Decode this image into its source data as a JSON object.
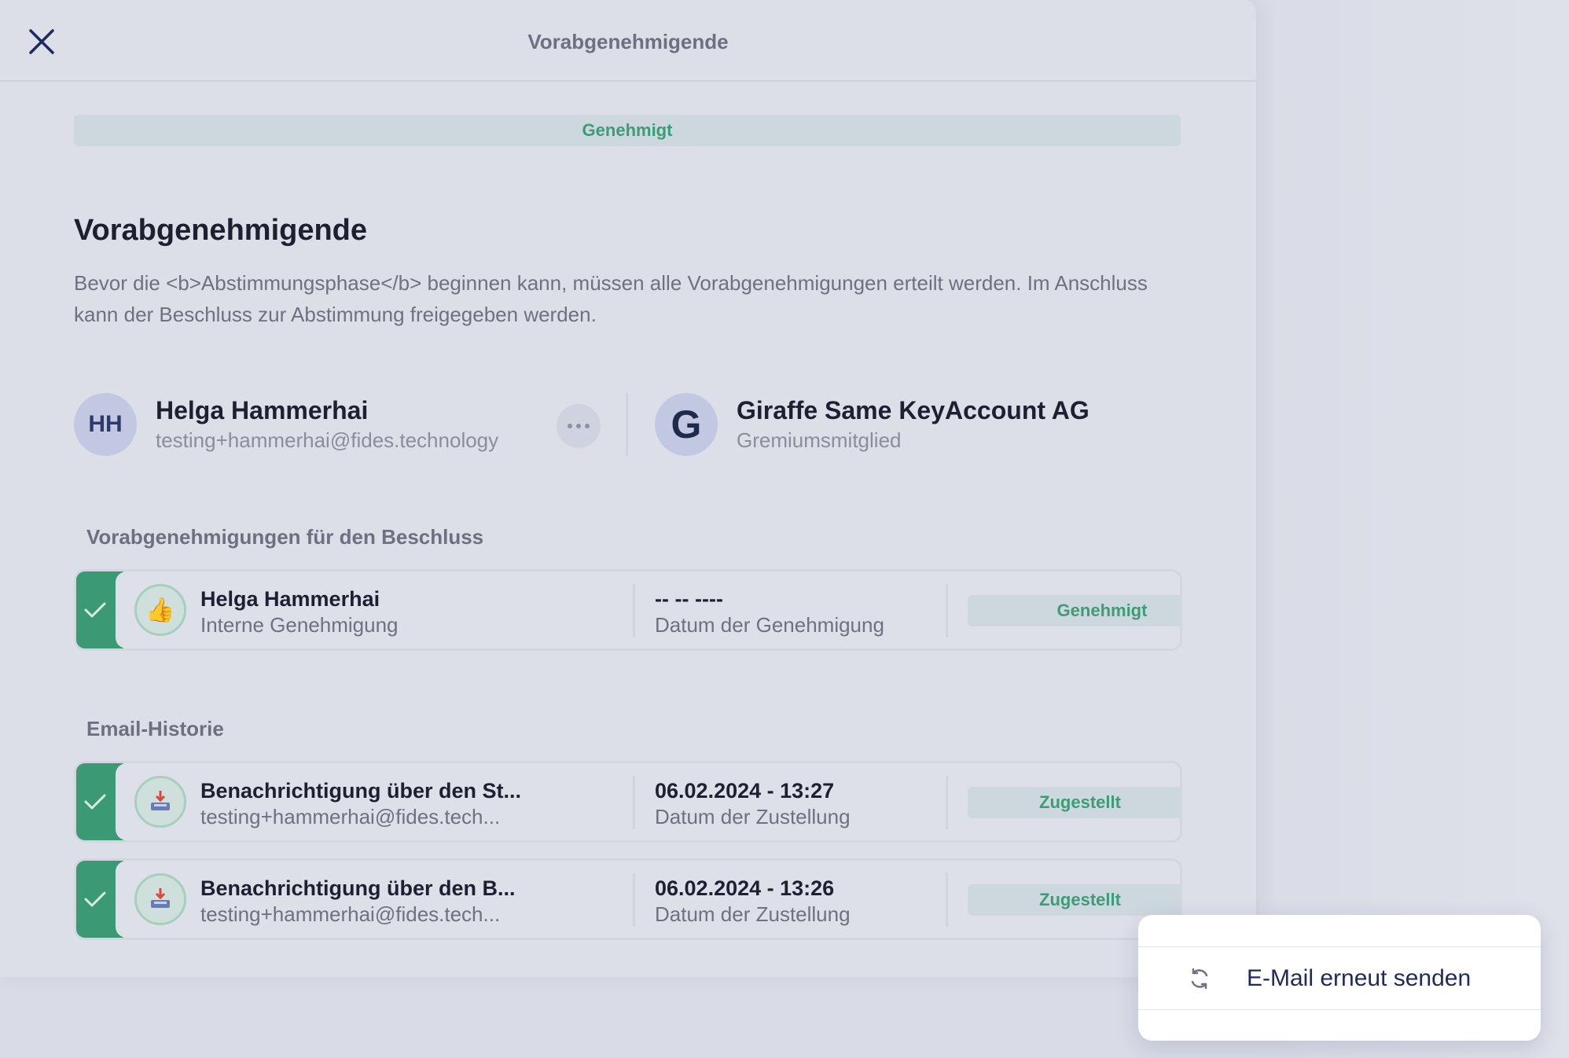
{
  "header": {
    "title": "Vorabgenehmigende"
  },
  "status": {
    "label": "Genehmigt"
  },
  "section": {
    "heading": "Vorabgenehmigende",
    "description": "Bevor die <b>Abstimmungsphase</b> beginnen kann, müssen alle Vorabgenehmigungen erteilt werden. Im Anschluss kann der Beschluss zur Abstimmung freigegeben werden."
  },
  "approver": {
    "initials": "HH",
    "name": "Helga Hammerhai",
    "email": "testing+hammerhai@fides.technology"
  },
  "organization": {
    "initial": "G",
    "name": "Giraffe Same KeyAccount AG",
    "role": "Gremiumsmitglied"
  },
  "approvals": {
    "heading": "Vorabgenehmigungen für den Beschluss",
    "items": [
      {
        "icon": "thumbs-up-icon",
        "title": "Helga Hammerhai",
        "subtitle": "Interne Genehmigung",
        "date": "-- -- ----",
        "date_label": "Datum der Genehmigung",
        "status": "Genehmigt"
      }
    ]
  },
  "email_history": {
    "heading": "Email-Historie",
    "items": [
      {
        "icon": "inbox-download-icon",
        "title": "Benachrichtigung über den St...",
        "subtitle": "testing+hammerhai@fides.tech...",
        "date": "06.02.2024 - 13:27",
        "date_label": "Datum der Zustellung",
        "status": "Zugestellt"
      },
      {
        "icon": "inbox-download-icon",
        "title": "Benachrichtigung über den B...",
        "subtitle": "testing+hammerhai@fides.tech...",
        "date": "06.02.2024 - 13:26",
        "date_label": "Datum der Zustellung",
        "status": "Zugestellt"
      }
    ]
  },
  "context_menu": {
    "items": [
      {
        "icon": "refresh-icon",
        "label": "E-Mail erneut senden"
      }
    ]
  },
  "colors": {
    "accent_green": "#3b9a73",
    "navy": "#1f2a5c",
    "panel_bg": "#dcdfe8"
  }
}
